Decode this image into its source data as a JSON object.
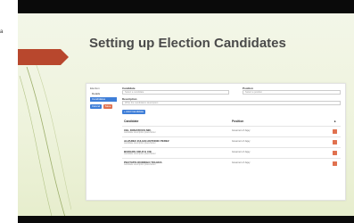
{
  "corner_label": "a",
  "slide": {
    "title": "Setting up Election Candidates"
  },
  "app": {
    "sidebar": {
      "title": "Election",
      "items": [
        {
          "label": "Details"
        },
        {
          "label": "Candidates"
        }
      ],
      "cancel_label": "Cancel",
      "save_label": "Save"
    },
    "form": {
      "candidate_label": "Candidate",
      "candidate_placeholder": "Select a candidate",
      "position_label": "Position",
      "position_placeholder": "Select a position",
      "description_label": "Description",
      "description_placeholder": "Write the candidate's description",
      "add_button_label": "+ Add Candidate"
    },
    "table": {
      "headers": [
        "Candidate",
        "Position"
      ],
      "rows": [
        {
          "name": "CEL DONATIVUS MR.",
          "sub": "candidate description placeholder",
          "position": "Governor of Jujuy"
        },
        {
          "name": "ALVAREZ JULIAN ANTONIO PEREZ",
          "sub": "candidate description placeholder",
          "position": "Governor of Jujuy"
        },
        {
          "name": "BURGOS CRUZ E CIE",
          "sub": "candidate description placeholder",
          "position": "Governor of Jujuy"
        },
        {
          "name": "PECTATIS RODRIGO TOLEDA",
          "sub": "candidate description placeholder",
          "position": "Governor of Jujuy"
        }
      ]
    }
  },
  "colors": {
    "accent": "#b8472d",
    "primary_button": "#3e7ed8",
    "danger_button": "#e0714f",
    "slide_background": "#eef3dc"
  }
}
